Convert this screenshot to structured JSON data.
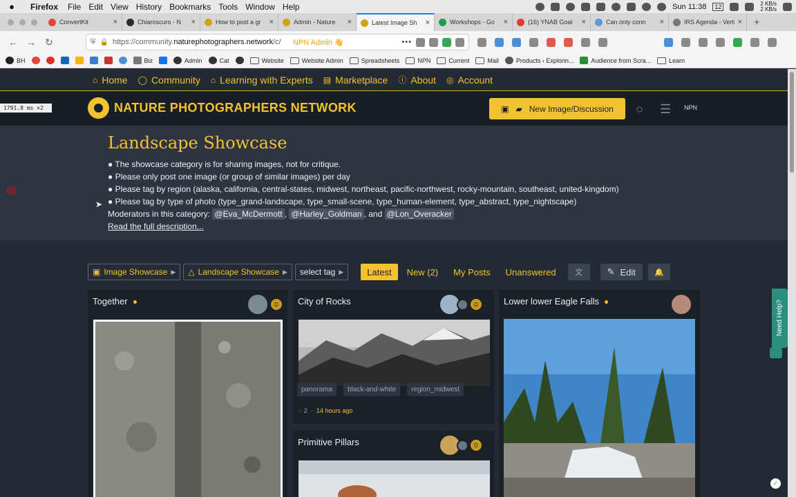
{
  "macos_menubar": {
    "app": "Firefox",
    "menus": [
      "File",
      "Edit",
      "View",
      "History",
      "Bookmarks",
      "Tools",
      "Window",
      "Help"
    ],
    "clock": "Sun 11:38",
    "battery": "12",
    "netspeed": [
      "2 KB/s",
      "2 KB/s"
    ]
  },
  "tabs": [
    {
      "title": "ConvertKit",
      "color": "#e0463a"
    },
    {
      "title": "Chiaroscuro - N",
      "color": "#2c2c2c"
    },
    {
      "title": "How to post a gr",
      "color": "#d1a31a"
    },
    {
      "title": "Admin - Nature",
      "color": "#d1a31a"
    },
    {
      "title": "Latest Image Sh",
      "color": "#d1a31a",
      "active": true
    },
    {
      "title": "Workshops - Go",
      "color": "#1e9e52"
    },
    {
      "title": "(16) YNAB Goal",
      "color": "#e53935"
    },
    {
      "title": "Can only conn",
      "color": "#5b9bd5"
    },
    {
      "title": "IRS Agenda - Verti",
      "color": "#777777"
    }
  ],
  "navbar": {
    "url_prefix": "https://community.",
    "url_domain": "naturephotographers.network",
    "url_path": "/c/",
    "admin_badge": "NPN Admin 👋"
  },
  "bookmarks": [
    "BH",
    "Biz",
    "Admin",
    "Cat",
    "Website",
    "Website Admin",
    "Spreadsheets",
    "NPN",
    "Current",
    "Mail",
    "Products ‹ Explorin...",
    "Audience from Scra...",
    "Learn"
  ],
  "site_nav": [
    "Home",
    "Community",
    "Learning with Experts",
    "Marketplace",
    "About",
    "Account"
  ],
  "header": {
    "logo_text": "NATURE PHOTOGRAPHERS NETWORK",
    "new_button": "New Image/Discussion",
    "npn_label": "NPN"
  },
  "timing": "1791.8 ms ×2",
  "category": {
    "title": "Landscape Showcase",
    "bullets": [
      "● The showcase category is for sharing images, not for critique.",
      "● Please only post one image (or group of similar images) per day",
      "● Please tag by region (alaska, california, central-states, midwest, northeast, pacific-northwest, rocky-mountain, southeast, united-kingdom)",
      "● Please tag by type of photo (type_grand-landscape, type_small-scene, type_human-element, type_abstract, type_nightscape)"
    ],
    "moderators_prefix": "Moderators in this category:",
    "moderators": [
      "@Eva_McDermott",
      "@Harley_Goldman",
      "@Lon_Overacker"
    ],
    "sep_comma": ",",
    "sep_and": ", and",
    "read_more": "Read the full description..."
  },
  "filters": {
    "image_showcase": "Image Showcase",
    "landscape_showcase": "Landscape Showcase",
    "select_tag": "select tag",
    "latest": "Latest",
    "new": "New (2)",
    "my_posts": "My Posts",
    "unanswered": "Unanswered",
    "edit": "Edit"
  },
  "topics": {
    "together": {
      "title": "Together"
    },
    "city_of_rocks": {
      "title": "City of Rocks",
      "tags": [
        "panorama",
        "black-and-white",
        "region_midwest"
      ],
      "replies": "2",
      "separator": "·",
      "ago": "14 hours ago"
    },
    "primitive_pillars": {
      "title": "Primitive Pillars"
    },
    "eagle_falls": {
      "title": "Lower lower Eagle Falls"
    }
  },
  "help_tab": "Need Help?",
  "colors": {
    "accent": "#f2c230",
    "banner": "#2e3540",
    "background": "#222a33"
  }
}
